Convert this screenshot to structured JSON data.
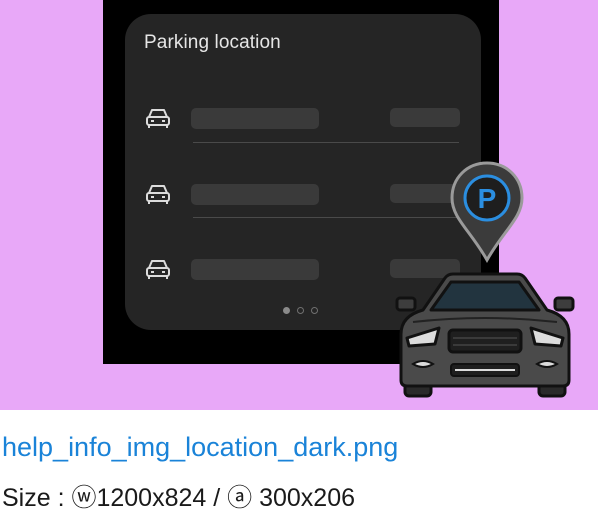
{
  "illustration": {
    "background_color": "#e8a8f8",
    "card": {
      "title": "Parking location",
      "rows": [
        {
          "icon": "car-icon"
        },
        {
          "icon": "car-icon"
        },
        {
          "icon": "car-icon"
        }
      ],
      "page_indicator": {
        "total": 3,
        "active": 1
      }
    },
    "pin": {
      "label": "P",
      "icon": "parking-pin-icon"
    },
    "car": {
      "icon": "car-front-icon"
    }
  },
  "caption": {
    "filename": "help_info_img_location_dark.png",
    "size_label": "Size : ⓦ1200x824 / ⓐ 300x206"
  },
  "colors": {
    "link": "#1a83d8",
    "pin_accent": "#2b8ee0"
  }
}
